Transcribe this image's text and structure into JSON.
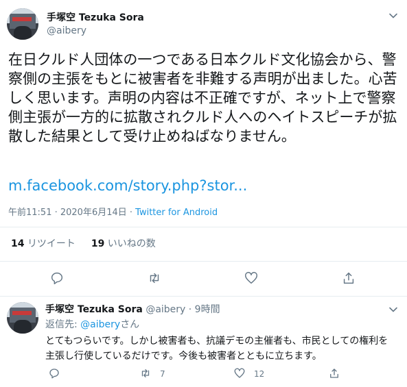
{
  "tweet": {
    "author_name": "手塚空 Tezuka Sora",
    "author_handle": "@aibery",
    "text": "在日クルド人団体の一つである日本クルド文化協会から、警察側の主張をもとに被害者を非難する声明が出ました。心苦しく思います。声明の内容は不正確ですが、ネット上で警察側主張が一方的に拡散されクルド人へのヘイトスピーチが拡散した結果として受け止めねばなりません。",
    "link": "m.facebook.com/story.php?stor...",
    "time": "午前11:51 · 2020年6月14日 · ",
    "source": "Twitter for Android",
    "retweet_count": "14",
    "retweet_label": "リツイート",
    "like_count": "19",
    "like_label": "いいねの数"
  },
  "reply": {
    "author_name": "手塚空 Tezuka Sora",
    "author_handle": "@aibery · 9時間",
    "replying_prefix": "返信先: ",
    "replying_mention": "@aibery",
    "replying_suffix": "さん",
    "text": "とてもつらいです。しかし被害者も、抗議デモの主催者も、市民としての権利を主張し行使しているだけです。今後も被害者とともに立ちます。",
    "retweet_count": "7",
    "like_count": "12"
  },
  "colors": {
    "text": "#14171a",
    "secondary": "#657786",
    "link": "#1b95e0",
    "divider": "#e6ecf0"
  },
  "icons": [
    "chevron-down-icon",
    "reply-icon",
    "retweet-icon",
    "like-icon",
    "share-icon"
  ]
}
